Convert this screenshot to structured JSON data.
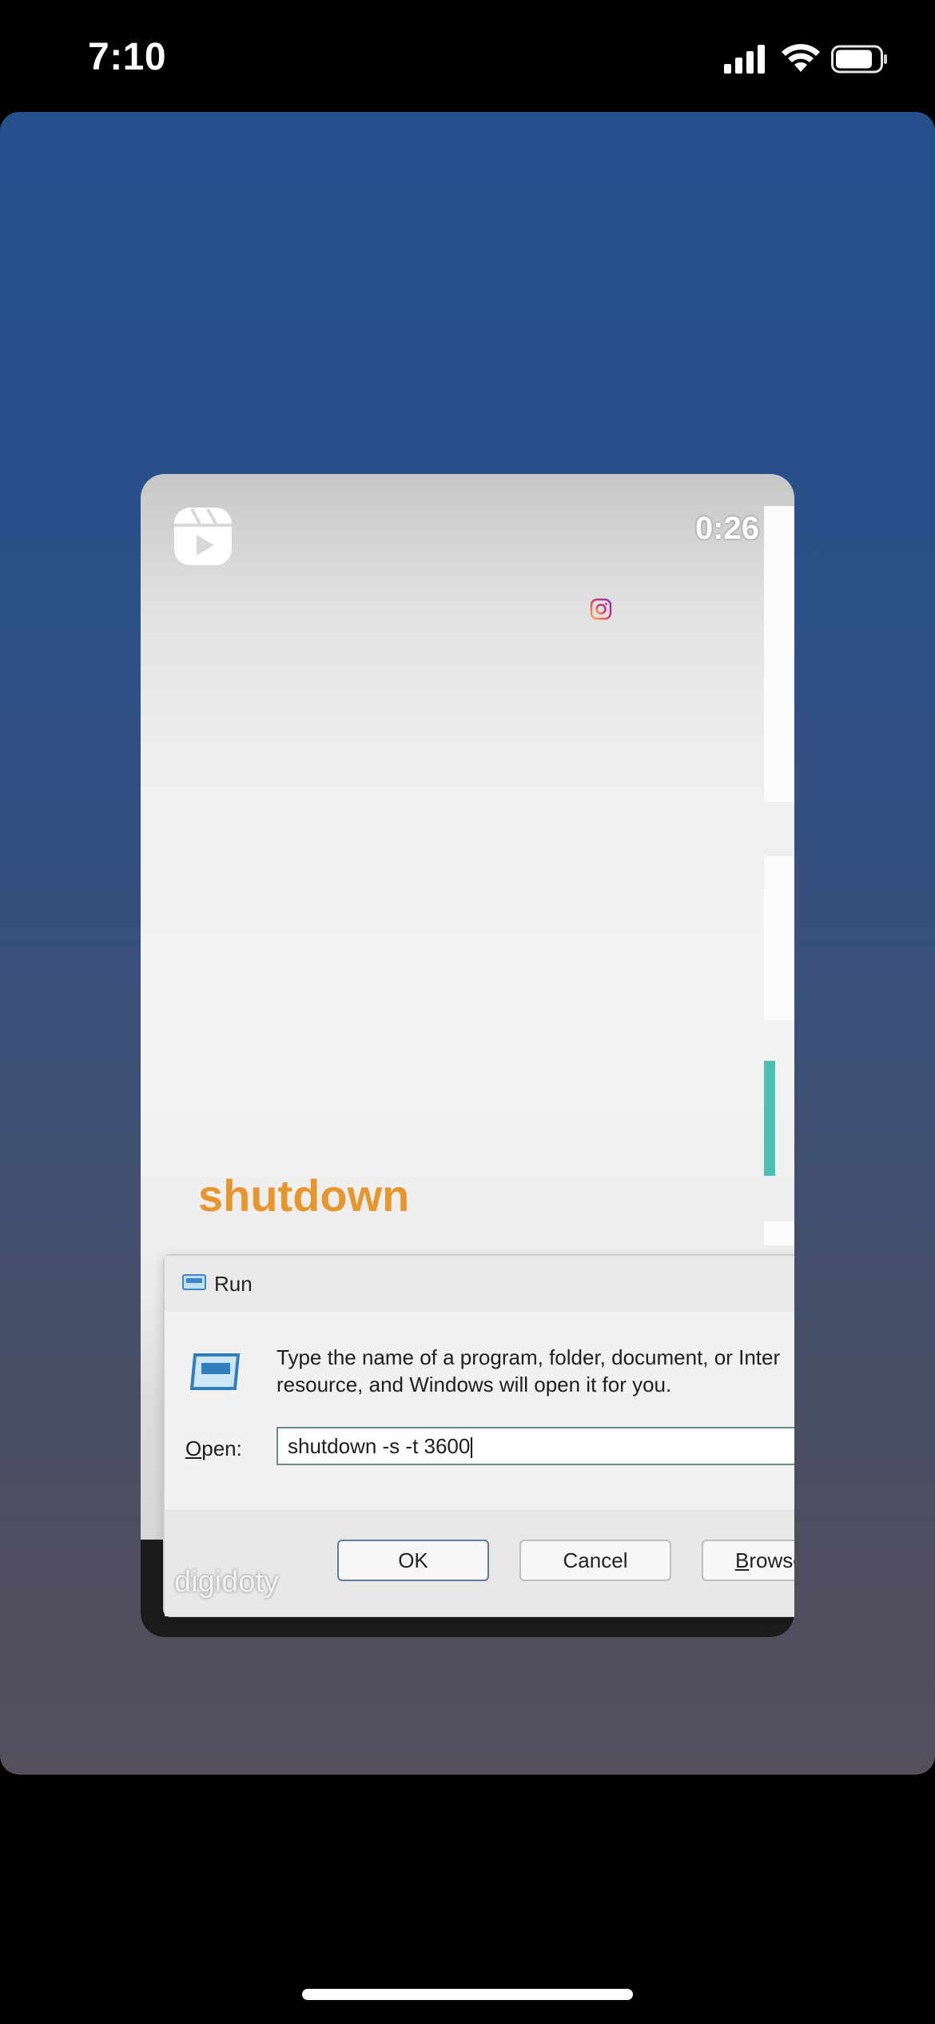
{
  "status_bar": {
    "time": "7:10",
    "icons": [
      "cellular-signal-icon",
      "wifi-icon",
      "battery-icon"
    ]
  },
  "reel": {
    "duration": "0:26",
    "overlay_text": "shutdown",
    "watermark": "digidoty",
    "icons": [
      "reels-logo-icon",
      "instagram-icon"
    ]
  },
  "run_dialog": {
    "title": "Run",
    "description_line1": "Type the name of a program, folder, document, or Inter",
    "description_line2": "resource, and Windows will open it for you.",
    "open_label_prefix": "O",
    "open_label_rest": "pen:",
    "input_value": "shutdown -s -t 3600",
    "ok_label": "OK",
    "cancel_label": "Cancel",
    "browse_prefix": "B",
    "browse_rest": "rowse"
  },
  "colors": {
    "overlay_text": "#e7962d",
    "accent_teal": "#4fbfb3",
    "card_top": "#26508c",
    "card_bottom": "#554f5c"
  }
}
